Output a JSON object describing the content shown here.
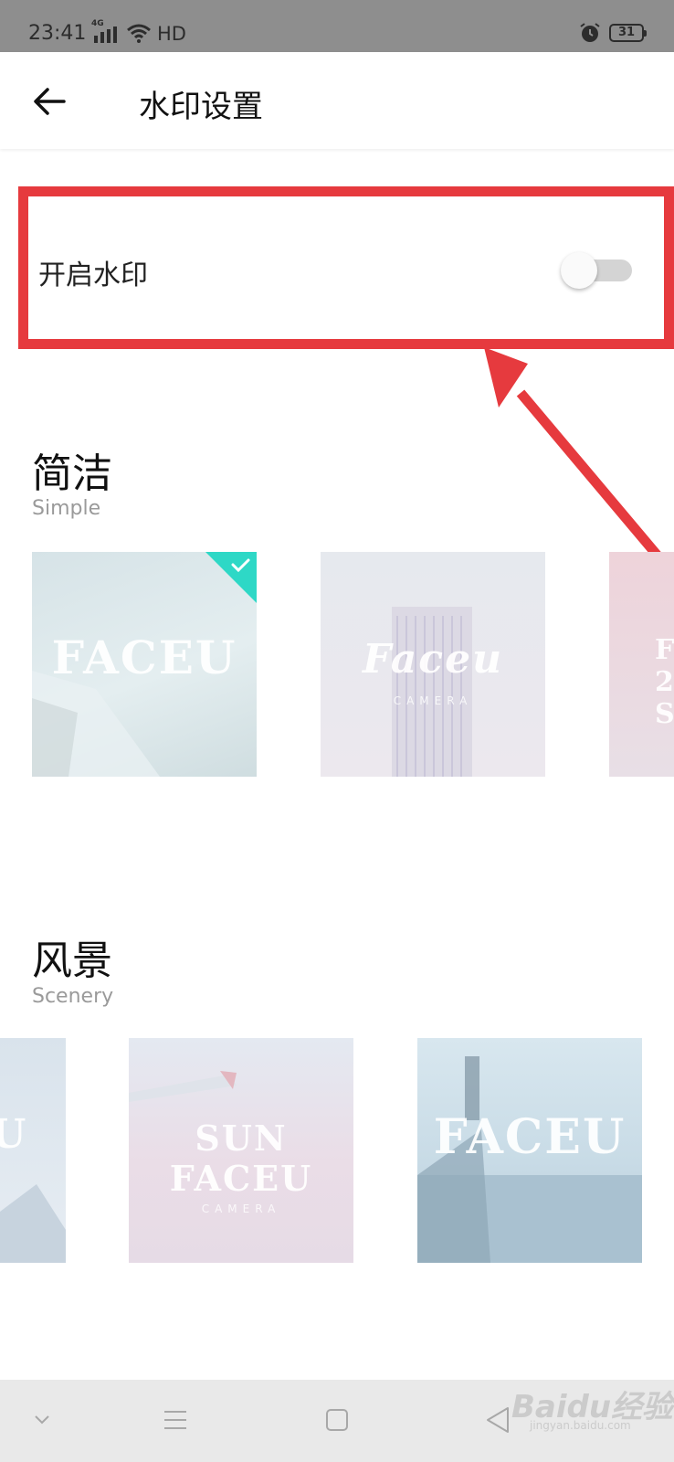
{
  "status_bar": {
    "time": "23:41",
    "network": "4G",
    "hd": "HD",
    "battery": "31"
  },
  "app_bar": {
    "title": "水印设置"
  },
  "watermark_toggle": {
    "label": "开启水印",
    "enabled": false
  },
  "sections": [
    {
      "title": "简洁",
      "subtitle": "Simple",
      "items": [
        {
          "text": "FACEU",
          "selected": true
        },
        {
          "text": "Faceu",
          "sub": "CAMERA",
          "selected": false
        },
        {
          "text": "F 2 S",
          "selected": false
        }
      ]
    },
    {
      "title": "风景",
      "subtitle": "Scenery",
      "items": [
        {
          "text": "U",
          "selected": false
        },
        {
          "text": "SUN FACEU",
          "sub": "CAMERA",
          "selected": false
        },
        {
          "text": "FACEU",
          "selected": false
        }
      ]
    }
  ],
  "watermark_overlay": {
    "brand": "Baidu经验",
    "url": "jingyan.baidu.com"
  },
  "colors": {
    "highlight": "#e63a3e",
    "check_teal": "#2ed8c6",
    "status_bar": "#8e8e8e"
  },
  "icons": [
    "back-arrow-icon",
    "signal-icon",
    "wifi-icon",
    "alarm-icon",
    "battery-icon",
    "check-icon",
    "nav-collapse-icon",
    "nav-menu-icon",
    "nav-home-icon",
    "nav-back-icon"
  ]
}
